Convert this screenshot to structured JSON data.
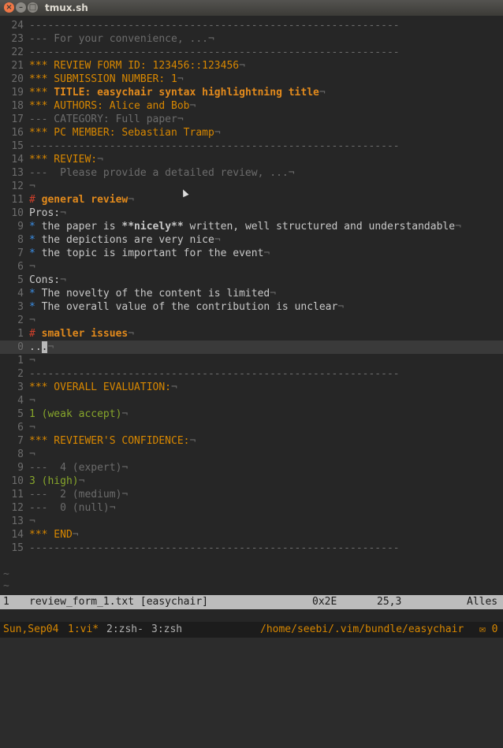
{
  "window": {
    "title": "tmux.sh",
    "close_glyph": "×",
    "min_glyph": "–",
    "max_glyph": "□"
  },
  "lines": [
    {
      "num": "24",
      "parts": [
        {
          "c": "gray",
          "t": "------------------------------------------------------------"
        }
      ]
    },
    {
      "num": "23",
      "parts": [
        {
          "c": "gray",
          "t": "--- For your convenience, ...¬"
        }
      ]
    },
    {
      "num": "22",
      "parts": [
        {
          "c": "gray",
          "t": "------------------------------------------------------------"
        }
      ]
    },
    {
      "num": "21",
      "parts": [
        {
          "c": "orange",
          "t": "*** REVIEW FORM ID: 123456::123456"
        },
        {
          "c": "gray",
          "t": "¬"
        }
      ]
    },
    {
      "num": "20",
      "parts": [
        {
          "c": "orange",
          "t": "*** SUBMISSION NUMBER: 1"
        },
        {
          "c": "gray",
          "t": "¬"
        }
      ]
    },
    {
      "num": "19",
      "parts": [
        {
          "c": "orange",
          "t": "*** "
        },
        {
          "c": "bold-orange",
          "t": "TITLE: easychair syntax highlightning title"
        },
        {
          "c": "gray",
          "t": "¬"
        }
      ]
    },
    {
      "num": "18",
      "parts": [
        {
          "c": "orange",
          "t": "*** AUTHORS: Alice and Bob"
        },
        {
          "c": "gray",
          "t": "¬"
        }
      ]
    },
    {
      "num": "17",
      "parts": [
        {
          "c": "gray",
          "t": "--- CATEGORY: Full paper¬"
        }
      ]
    },
    {
      "num": "16",
      "parts": [
        {
          "c": "orange",
          "t": "*** PC MEMBER: Sebastian Tramp"
        },
        {
          "c": "gray",
          "t": "¬"
        }
      ]
    },
    {
      "num": "15",
      "parts": [
        {
          "c": "gray",
          "t": "------------------------------------------------------------"
        }
      ]
    },
    {
      "num": "14",
      "parts": [
        {
          "c": "orange",
          "t": "*** REVIEW:"
        },
        {
          "c": "gray",
          "t": "¬"
        }
      ]
    },
    {
      "num": "13",
      "parts": [
        {
          "c": "gray",
          "t": "---  Please provide a detailed review, ...¬"
        }
      ]
    },
    {
      "num": "12",
      "parts": [
        {
          "c": "gray",
          "t": "¬"
        }
      ]
    },
    {
      "num": "11",
      "parts": [
        {
          "c": "red",
          "t": "# "
        },
        {
          "c": "bold-orange",
          "t": "general review"
        },
        {
          "c": "gray",
          "t": "¬"
        }
      ]
    },
    {
      "num": "10",
      "parts": [
        {
          "c": "white",
          "t": "Pros:"
        },
        {
          "c": "gray",
          "t": "¬"
        }
      ]
    },
    {
      "num": "9",
      "parts": [
        {
          "c": "blue",
          "t": "* "
        },
        {
          "c": "white",
          "t": "the paper is "
        },
        {
          "c": "white",
          "t": "**nicely**",
          "b": true
        },
        {
          "c": "white",
          "t": " written, well structured and understandable"
        },
        {
          "c": "gray",
          "t": "¬"
        }
      ]
    },
    {
      "num": "8",
      "parts": [
        {
          "c": "blue",
          "t": "* "
        },
        {
          "c": "white",
          "t": "the depictions are very nice"
        },
        {
          "c": "gray",
          "t": "¬"
        }
      ]
    },
    {
      "num": "7",
      "parts": [
        {
          "c": "blue",
          "t": "* "
        },
        {
          "c": "white",
          "t": "the topic is important for the event"
        },
        {
          "c": "gray",
          "t": "¬"
        }
      ]
    },
    {
      "num": "6",
      "parts": [
        {
          "c": "gray",
          "t": "¬"
        }
      ]
    },
    {
      "num": "5",
      "parts": [
        {
          "c": "white",
          "t": "Cons:"
        },
        {
          "c": "gray",
          "t": "¬"
        }
      ]
    },
    {
      "num": "4",
      "parts": [
        {
          "c": "blue",
          "t": "* "
        },
        {
          "c": "white",
          "t": "The novelty of the content is limited"
        },
        {
          "c": "gray",
          "t": "¬"
        }
      ]
    },
    {
      "num": "3",
      "parts": [
        {
          "c": "blue",
          "t": "* "
        },
        {
          "c": "white",
          "t": "The overall value of the contribution is unclear"
        },
        {
          "c": "gray",
          "t": "¬"
        }
      ]
    },
    {
      "num": "2",
      "parts": [
        {
          "c": "gray",
          "t": "¬"
        }
      ]
    },
    {
      "num": "1",
      "parts": [
        {
          "c": "red",
          "t": "# "
        },
        {
          "c": "bold-orange",
          "t": "smaller issues"
        },
        {
          "c": "gray",
          "t": "¬"
        }
      ]
    },
    {
      "num": "0",
      "cur": true,
      "parts": [
        {
          "c": "white",
          "t": ".."
        },
        {
          "c": "cursor",
          "t": "."
        },
        {
          "c": "gray",
          "t": "¬"
        }
      ]
    },
    {
      "num": "1",
      "parts": [
        {
          "c": "gray",
          "t": "¬"
        }
      ]
    },
    {
      "num": "2",
      "parts": [
        {
          "c": "gray",
          "t": "------------------------------------------------------------"
        }
      ]
    },
    {
      "num": "3",
      "parts": [
        {
          "c": "orange",
          "t": "*** OVERALL EVALUATION:"
        },
        {
          "c": "gray",
          "t": "¬"
        }
      ]
    },
    {
      "num": "4",
      "parts": [
        {
          "c": "gray",
          "t": "¬"
        }
      ]
    },
    {
      "num": "5",
      "parts": [
        {
          "c": "green",
          "t": "1 (weak accept)"
        },
        {
          "c": "gray",
          "t": "¬"
        }
      ]
    },
    {
      "num": "6",
      "parts": [
        {
          "c": "gray",
          "t": "¬"
        }
      ]
    },
    {
      "num": "7",
      "parts": [
        {
          "c": "orange",
          "t": "*** REVIEWER'S CONFIDENCE:"
        },
        {
          "c": "gray",
          "t": "¬"
        }
      ]
    },
    {
      "num": "8",
      "parts": [
        {
          "c": "gray",
          "t": "¬"
        }
      ]
    },
    {
      "num": "9",
      "parts": [
        {
          "c": "gray",
          "t": "---  4 (expert)¬"
        }
      ]
    },
    {
      "num": "10",
      "parts": [
        {
          "c": "green",
          "t": "3 (high)"
        },
        {
          "c": "gray",
          "t": "¬"
        }
      ]
    },
    {
      "num": "11",
      "parts": [
        {
          "c": "gray",
          "t": "---  2 (medium)¬"
        }
      ]
    },
    {
      "num": "12",
      "parts": [
        {
          "c": "gray",
          "t": "---  0 (null)¬"
        }
      ]
    },
    {
      "num": "13",
      "parts": [
        {
          "c": "gray",
          "t": "¬"
        }
      ]
    },
    {
      "num": "14",
      "parts": [
        {
          "c": "orange",
          "t": "*** END"
        },
        {
          "c": "gray",
          "t": "¬"
        }
      ]
    },
    {
      "num": "15",
      "parts": [
        {
          "c": "gray",
          "t": "------------------------------------------------------------"
        }
      ]
    }
  ],
  "tildes": [
    "~",
    "~"
  ],
  "statusline": {
    "buffer_num": "1",
    "filename": "review_form_1.txt [easychair]",
    "hex": "0x2E",
    "position": "25,3",
    "scroll": "Alles"
  },
  "tmux": {
    "date": "Sun,Sep04",
    "win1": "1:vi*",
    "win2": "2:zsh-",
    "win3": "3:zsh",
    "path": "/home/seebi/.vim/bundle/easychair",
    "mail": "✉ 0"
  }
}
